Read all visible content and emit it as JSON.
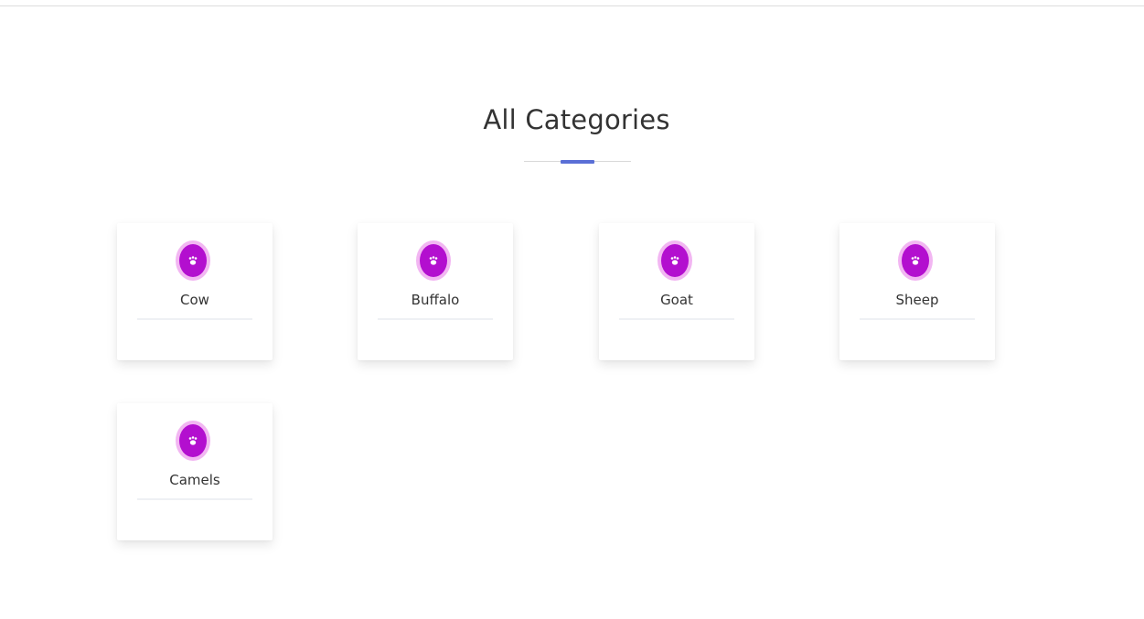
{
  "section": {
    "title": "All Categories"
  },
  "categories": [
    {
      "label": "Cow",
      "icon": "paw-icon"
    },
    {
      "label": "Buffalo",
      "icon": "paw-icon"
    },
    {
      "label": "Goat",
      "icon": "paw-icon"
    },
    {
      "label": "Sheep",
      "icon": "paw-icon"
    },
    {
      "label": "Camels",
      "icon": "paw-icon"
    }
  ],
  "colors": {
    "accent": "#5a6fd6",
    "icon_bg": "#b30fcf",
    "icon_ring": "#f2b6f2",
    "text": "#333333"
  }
}
